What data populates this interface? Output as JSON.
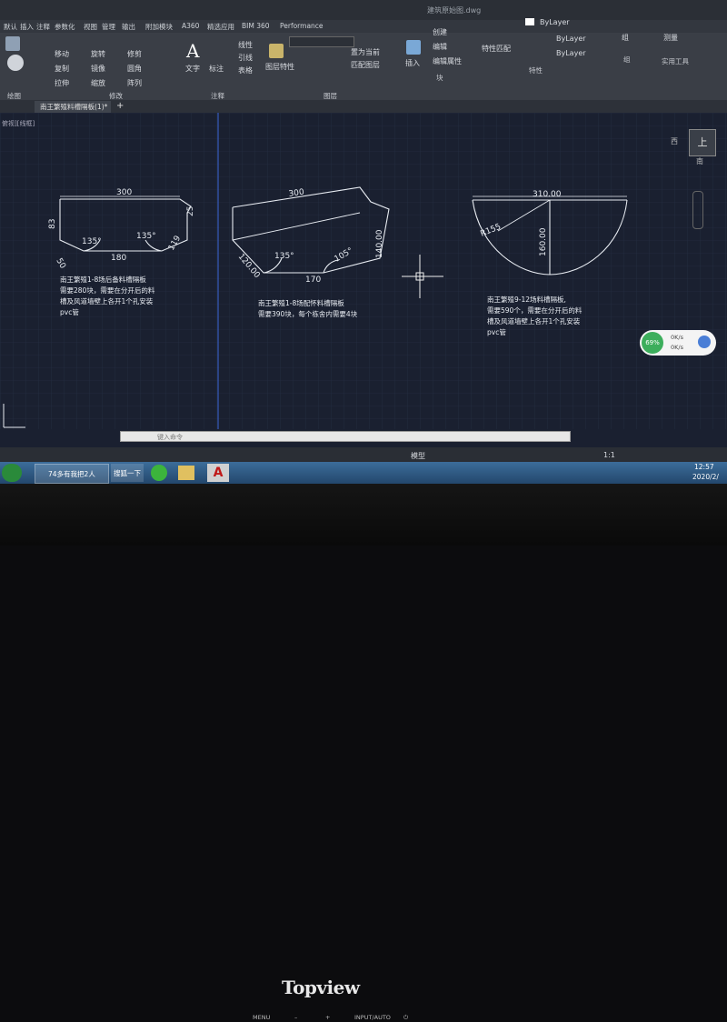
{
  "app": {
    "title": "建筑原始图.dwg",
    "file_tab": "南王繁殖料槽隔板(1)*",
    "viewport_label": "俯视][线框]",
    "command_placeholder": "键入命令",
    "tabs": [
      "默认",
      "插入",
      "注释",
      "参数化",
      "视图",
      "管理",
      "输出",
      "附加模块",
      "A360",
      "精选应用",
      "BIM 360",
      "Performance"
    ],
    "tab_shortcuts": {
      "default": "默认"
    }
  },
  "ribbon": {
    "draw_tools": [
      "直线",
      "多段线",
      "圆",
      "圆弧"
    ],
    "modify_tools": [
      "移动",
      "旋转",
      "修剪",
      "复制",
      "镜像",
      "圆角",
      "拉伸",
      "缩放",
      "阵列"
    ],
    "annotation_tools": [
      "文字",
      "标注",
      "线性",
      "引线",
      "表格"
    ],
    "layer_tools": [
      "图层特性",
      "置为当前",
      "匹配图层"
    ],
    "block_tools": [
      "插入",
      "创建",
      "编辑",
      "编辑属性"
    ],
    "property_tools": [
      "特性匹配",
      "ByLayer",
      "ByLayer",
      "ByLayer"
    ],
    "group_tools": [
      "组"
    ],
    "util_tools": [
      "测量",
      "实用工具"
    ],
    "panel_labels": [
      "绘图",
      "修改",
      "注释",
      "图层",
      "块",
      "特性",
      "组",
      "实用工具"
    ]
  },
  "drawing": {
    "shape1": {
      "dims": {
        "top": "300",
        "left": "83",
        "right_top": "25",
        "bottom": "180",
        "left_bottom": "50",
        "right_bottom": "119",
        "angle_left": "135°",
        "angle_right": "135°"
      },
      "note_lines": [
        "南王繁殖1-8场后备料槽隔板",
        "需要280块，需要在分开后的料",
        "槽及风道墙壁上各开1个孔安装",
        "pvc管"
      ]
    },
    "shape2": {
      "dims": {
        "top": "300",
        "left": "120.00",
        "bottom": "170",
        "right": "140.00",
        "angle_left": "135°",
        "angle_right": "105°"
      },
      "note_lines": [
        "南王繁殖1-8场配怀料槽隔板",
        "需要390块，每个栋舍内需要4块"
      ]
    },
    "shape3": {
      "dims": {
        "top": "310.00",
        "radius": "R155",
        "height": "160.00"
      },
      "note_lines": [
        "南王繁殖9-12场料槽隔板,",
        "需要590个，需要在分开后的料",
        "槽及风道墙壁上各开1个孔安装",
        "pvc管"
      ]
    },
    "viewcube": {
      "north": "北",
      "south": "南",
      "west": "西",
      "east": "东",
      "top": "上"
    },
    "widget": {
      "percent": "69%",
      "up": "0K/s",
      "down": "0K/s"
    }
  },
  "status": {
    "model": "模型",
    "scale": "1:1",
    "time": "12:57",
    "date": "2020/2/"
  },
  "taskbar": {
    "items": [
      "74多有我把2人",
      "搜狐一下",
      "",
      "",
      "A"
    ]
  },
  "bezel": {
    "brand": "Topview",
    "buttons": [
      "MENU",
      "–",
      "+",
      "INPUT/AUTO",
      "⏻"
    ]
  },
  "colors": {
    "accent": "#2b5fa8",
    "drawing_bg": "#1a2030",
    "lines": "#e8ecf2"
  }
}
